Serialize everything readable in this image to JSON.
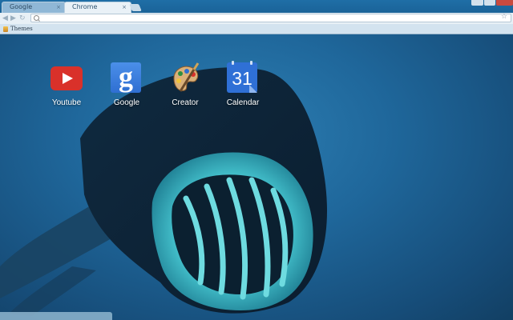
{
  "tabs": [
    {
      "label": "Google"
    },
    {
      "label": "Chrome"
    }
  ],
  "tab_close_symbol": "×",
  "bookmarks": {
    "items": [
      {
        "label": "Themes",
        "icon": "theme-icon"
      }
    ]
  },
  "omnibox": {
    "value": "",
    "placeholder": ""
  },
  "apps": [
    {
      "label": "Youtube",
      "icon": "youtube-icon"
    },
    {
      "label": "Google",
      "icon": "google-icon"
    },
    {
      "label": "Creator",
      "icon": "palette-icon"
    },
    {
      "label": "Calendar",
      "icon": "calendar-icon",
      "number": "31"
    }
  ],
  "google_letter": "g",
  "colors": {
    "tabstrip": "#1f6ea6",
    "toolbar": "#e8f0f6",
    "youtube_red": "#d9312a",
    "google_blue": "#2f6fd2",
    "calendar_blue": "#2f70d6",
    "background_blue": "#1f679b"
  }
}
